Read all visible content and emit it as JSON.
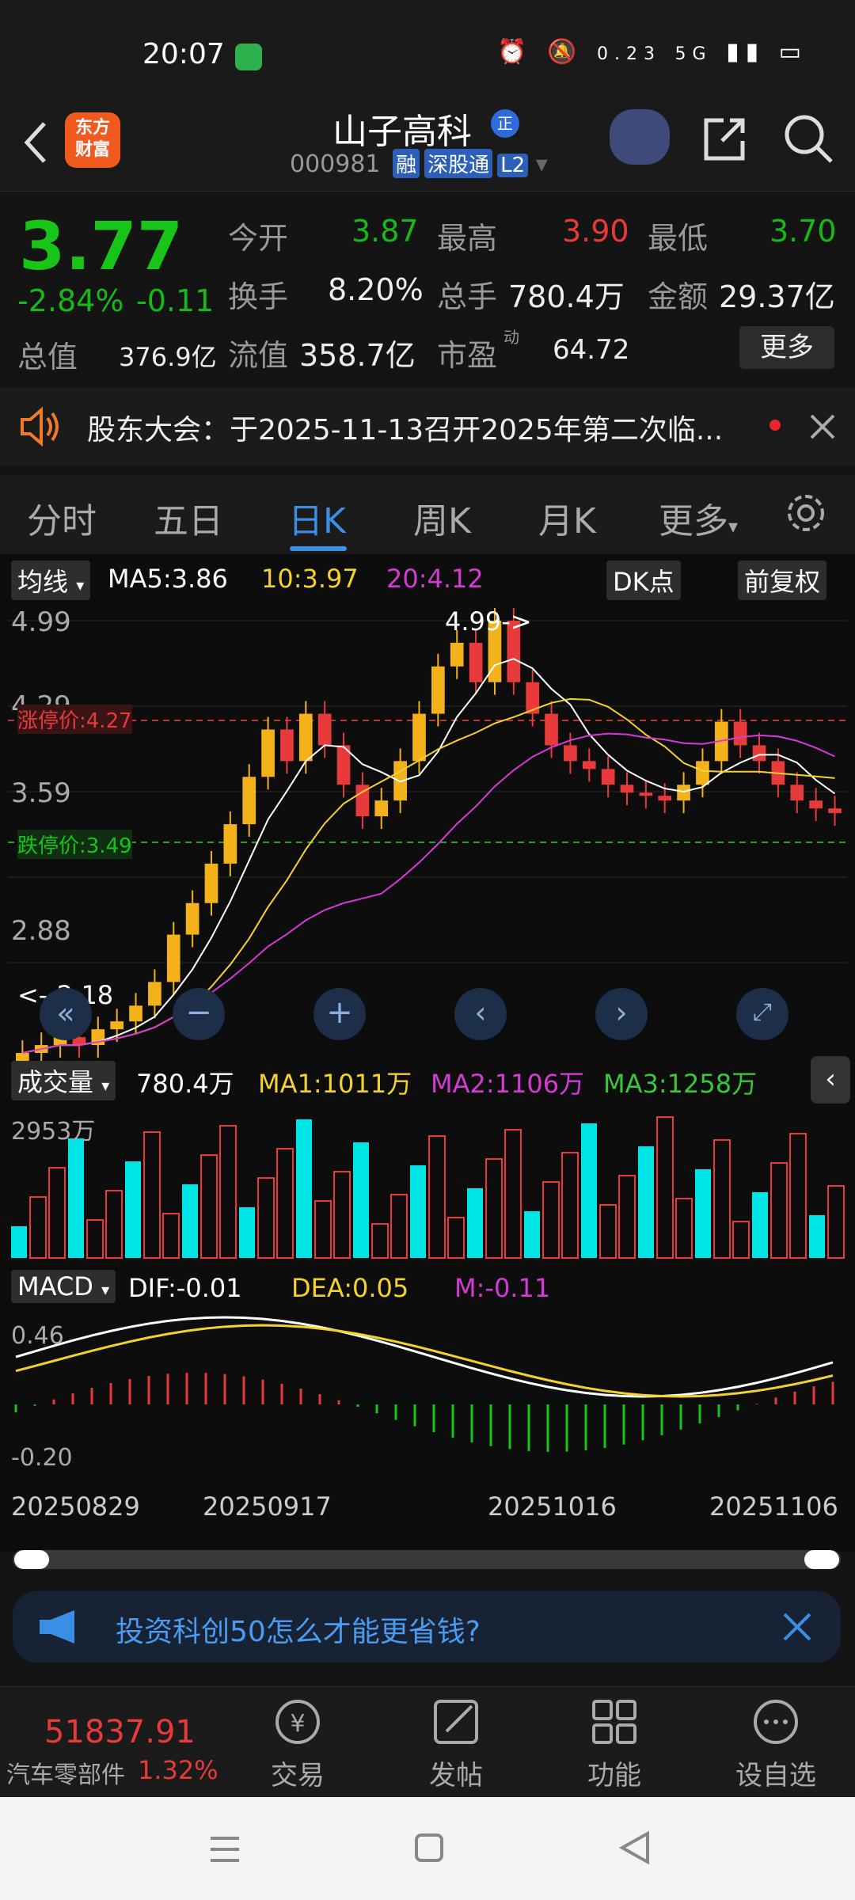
{
  "status": {
    "time": "20:07",
    "net_speed": "0.23",
    "net_unit": "KB/S",
    "signal": "5G"
  },
  "header": {
    "logo": "东方\n财富",
    "name": "山子高科",
    "flag": "正",
    "code": "000981",
    "tags": [
      "融",
      "深股通",
      "L2"
    ]
  },
  "quote": {
    "price": "3.77",
    "pct": "-2.84%",
    "chg": "-0.11",
    "open_label": "今开",
    "open": "3.87",
    "high_label": "最高",
    "high": "3.90",
    "low_label": "最低",
    "low": "3.70",
    "turnover_label": "换手",
    "turnover": "8.20%",
    "vol_label": "总手",
    "vol": "780.4万",
    "amount_label": "金额",
    "amount": "29.37亿",
    "mktcap_label": "总值",
    "mktcap": "376.9亿",
    "float_label": "流值",
    "float": "358.7亿",
    "pe_label": "市盈",
    "pe_sup": "动",
    "pe": "64.72",
    "more": "更多"
  },
  "notice": {
    "text": "股东大会：于2025-11-13召开2025年第二次临..."
  },
  "tabs": [
    "分时",
    "五日",
    "日K",
    "周K",
    "月K",
    "更多"
  ],
  "kline": {
    "indicator": "均线",
    "ma5": "MA5:3.86",
    "ma10": "10:3.97",
    "ma20": "20:4.12",
    "dk": "DK点",
    "adj": "前复权",
    "y_top": "4.99",
    "y_2": "4.29",
    "y_3": "3.59",
    "y_4": "2.88",
    "y_low": "2.18",
    "limit_up": "涨停价:4.27",
    "limit_down": "跌停价:3.49",
    "peak": "4.99->",
    "low_marker": "<--2.18"
  },
  "volume": {
    "label": "成交量",
    "val": "780.4万",
    "ma1": "MA1:1011万",
    "ma2": "MA2:1106万",
    "ma3": "MA3:1258万",
    "y_top": "2953万"
  },
  "macd": {
    "label": "MACD",
    "dif": "DIF:-0.01",
    "dea": "DEA:0.05",
    "m": "M:-0.11",
    "y_top": "0.46",
    "y_bot": "-0.20"
  },
  "dates": [
    "20250829",
    "20250917",
    "20251016",
    "20251106"
  ],
  "ad": {
    "text": "投资科创50怎么才能更省钱?"
  },
  "bottom": {
    "index_val": "51837.91",
    "sector": "汽车零部件",
    "sector_pct": "1.32%",
    "items": [
      "交易",
      "发帖",
      "功能",
      "设自选"
    ]
  },
  "colors": {
    "up": "#e83a3a",
    "down": "#19c419",
    "accent": "#3a8ee6",
    "vol_down": "#00e5e5"
  }
}
